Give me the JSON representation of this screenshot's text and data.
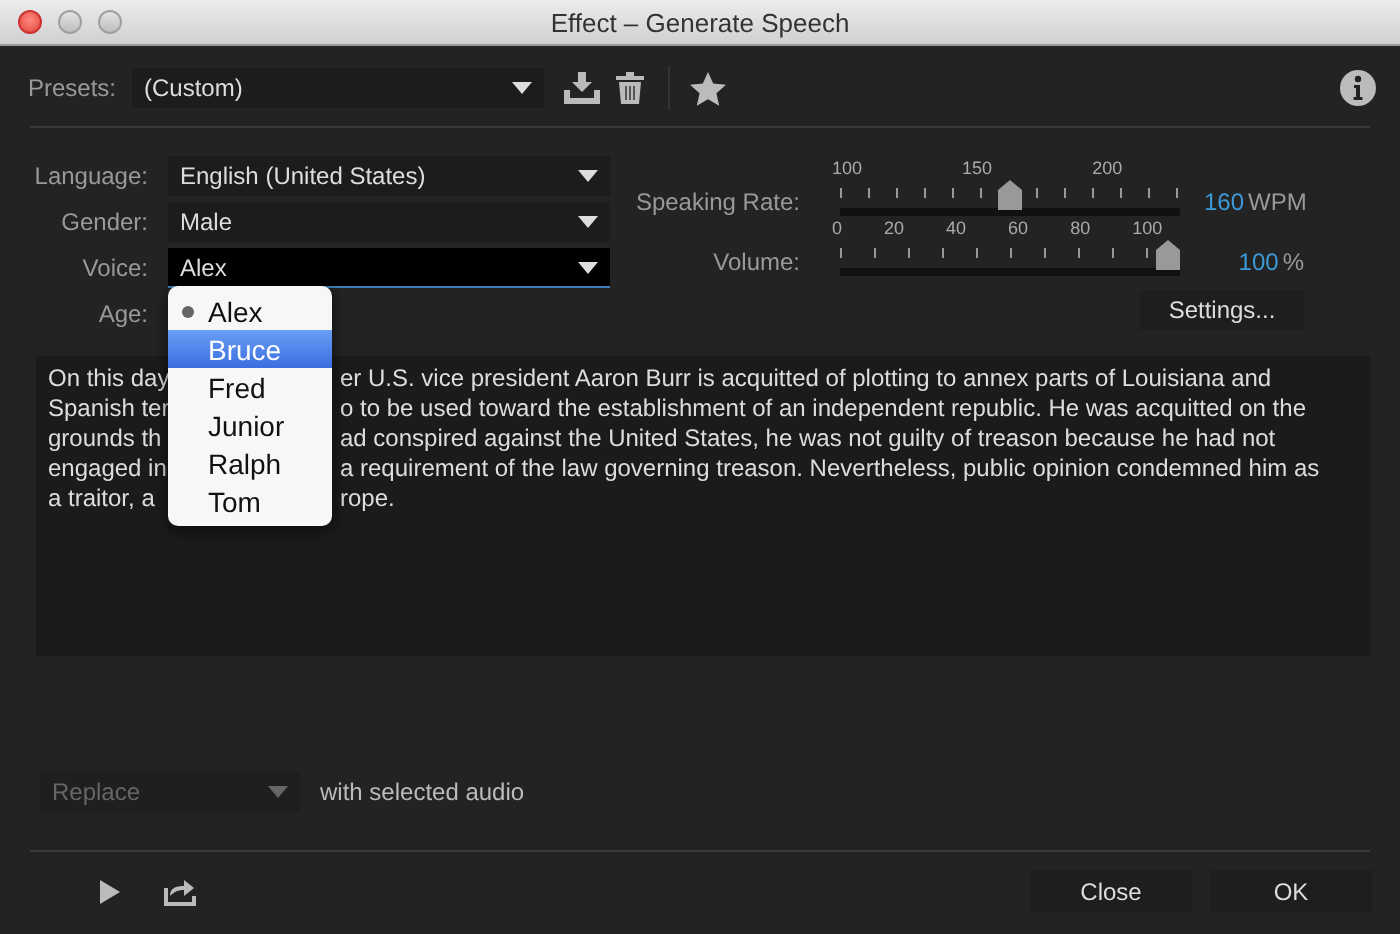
{
  "window": {
    "title": "Effect – Generate Speech"
  },
  "presets": {
    "label": "Presets:",
    "value": "(Custom)"
  },
  "fields": [
    {
      "label": "Language:",
      "value": "English (United States)",
      "focused": false
    },
    {
      "label": "Gender:",
      "value": "Male",
      "focused": false
    },
    {
      "label": "Voice:",
      "value": "Alex",
      "focused": true
    }
  ],
  "age_label": "Age:",
  "sliders": [
    {
      "label": "Speaking Rate:",
      "ticks": [
        "100",
        "150",
        "200"
      ],
      "level": 0.5,
      "reading": "160",
      "unit": "WPM"
    },
    {
      "label": "Volume:",
      "ticks": [
        "0",
        "20",
        "40",
        "60",
        "80",
        "100"
      ],
      "level": 1,
      "reading": "100",
      "unit": "%"
    }
  ],
  "settings_button": "Settings...",
  "text_lines": [
    {
      "start": "On this day",
      "end": "er U.S. vice president Aaron Burr is acquitted of plotting to annex parts of Louisiana and"
    },
    {
      "start": "Spanish ter",
      "end": "o to be used toward the establishment of an independent republic. He was acquitted on the"
    },
    {
      "start": "grounds th",
      "end": "ad conspired against the United States, he was not guilty of treason because he had not"
    },
    {
      "start": "engaged in",
      "end": "a requirement of the law governing treason. Nevertheless, public opinion condemned him as"
    },
    {
      "start": "a traitor, a",
      "end": "rope."
    }
  ],
  "voice_menu": [
    {
      "label": "Alex",
      "checked": true,
      "selected": false
    },
    {
      "label": "Bruce",
      "checked": false,
      "selected": true
    },
    {
      "label": "Fred",
      "checked": false,
      "selected": false
    },
    {
      "label": "Junior",
      "checked": false,
      "selected": false
    },
    {
      "label": "Ralph",
      "checked": false,
      "selected": false
    },
    {
      "label": "Tom",
      "checked": false,
      "selected": false
    }
  ],
  "replace": {
    "value": "Replace",
    "disabled": true
  },
  "replace_note": "with selected audio",
  "buttons": [
    "Close",
    "OK"
  ]
}
